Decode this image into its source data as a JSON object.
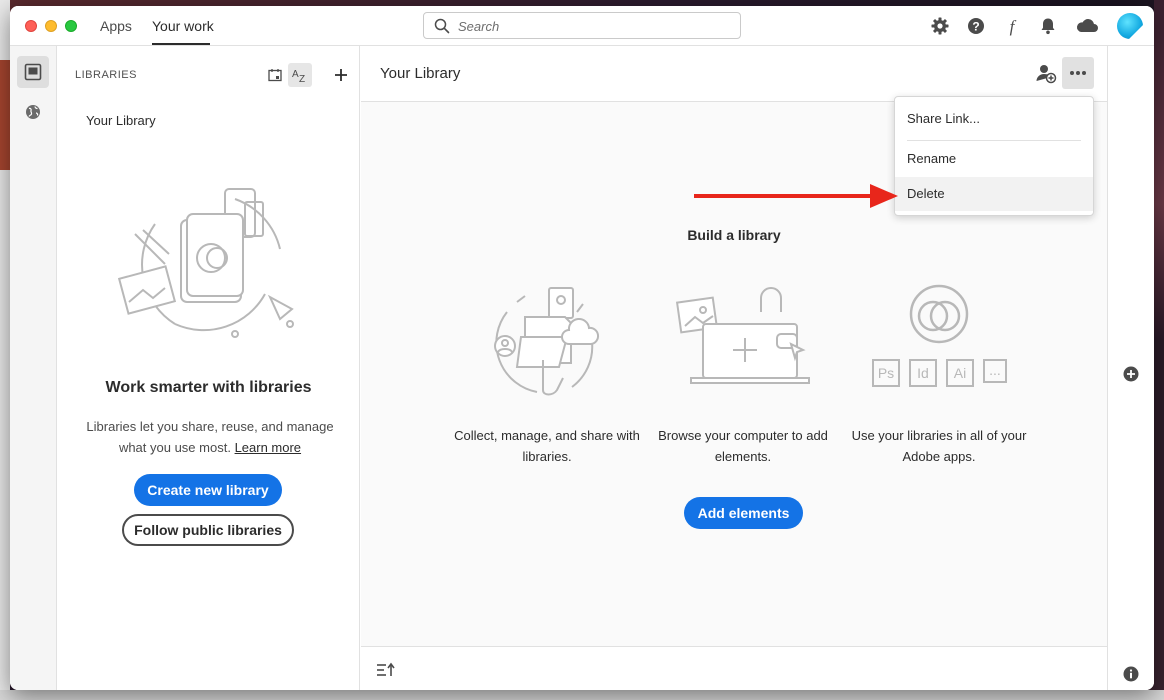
{
  "titlebar": {
    "tabs": [
      {
        "label": "Apps"
      },
      {
        "label": "Your work"
      }
    ],
    "search_placeholder": "Search",
    "icons": [
      "gear-icon",
      "help-icon",
      "fonts-icon",
      "bell-icon",
      "cloud-icon",
      "avatar"
    ]
  },
  "rail": {
    "items": [
      "libraries-icon",
      "globe-icon"
    ]
  },
  "libraries": {
    "header": "LIBRARIES",
    "items": [
      {
        "label": "Your Library"
      }
    ],
    "empty_title": "Work smarter with libraries",
    "empty_desc": "Libraries let you share, reuse, and manage what you use most.",
    "learn_more": "Learn more",
    "create_button": "Create new library",
    "follow_button": "Follow public libraries"
  },
  "main": {
    "title": "Your Library",
    "build_title": "Build a library",
    "features": [
      {
        "text": "Collect, manage, and share with libraries."
      },
      {
        "text": "Browse your computer to add elements."
      },
      {
        "text": "Use your libraries in all of your Adobe apps."
      }
    ],
    "app_badges": [
      "Ps",
      "Id",
      "Ai",
      "..."
    ],
    "add_button": "Add elements"
  },
  "menu": {
    "items": [
      {
        "label": "Share Link..."
      },
      {
        "label": "Rename"
      },
      {
        "label": "Delete"
      }
    ]
  },
  "colors": {
    "accent": "#1473e6",
    "annotation_arrow": "#e8261b"
  }
}
